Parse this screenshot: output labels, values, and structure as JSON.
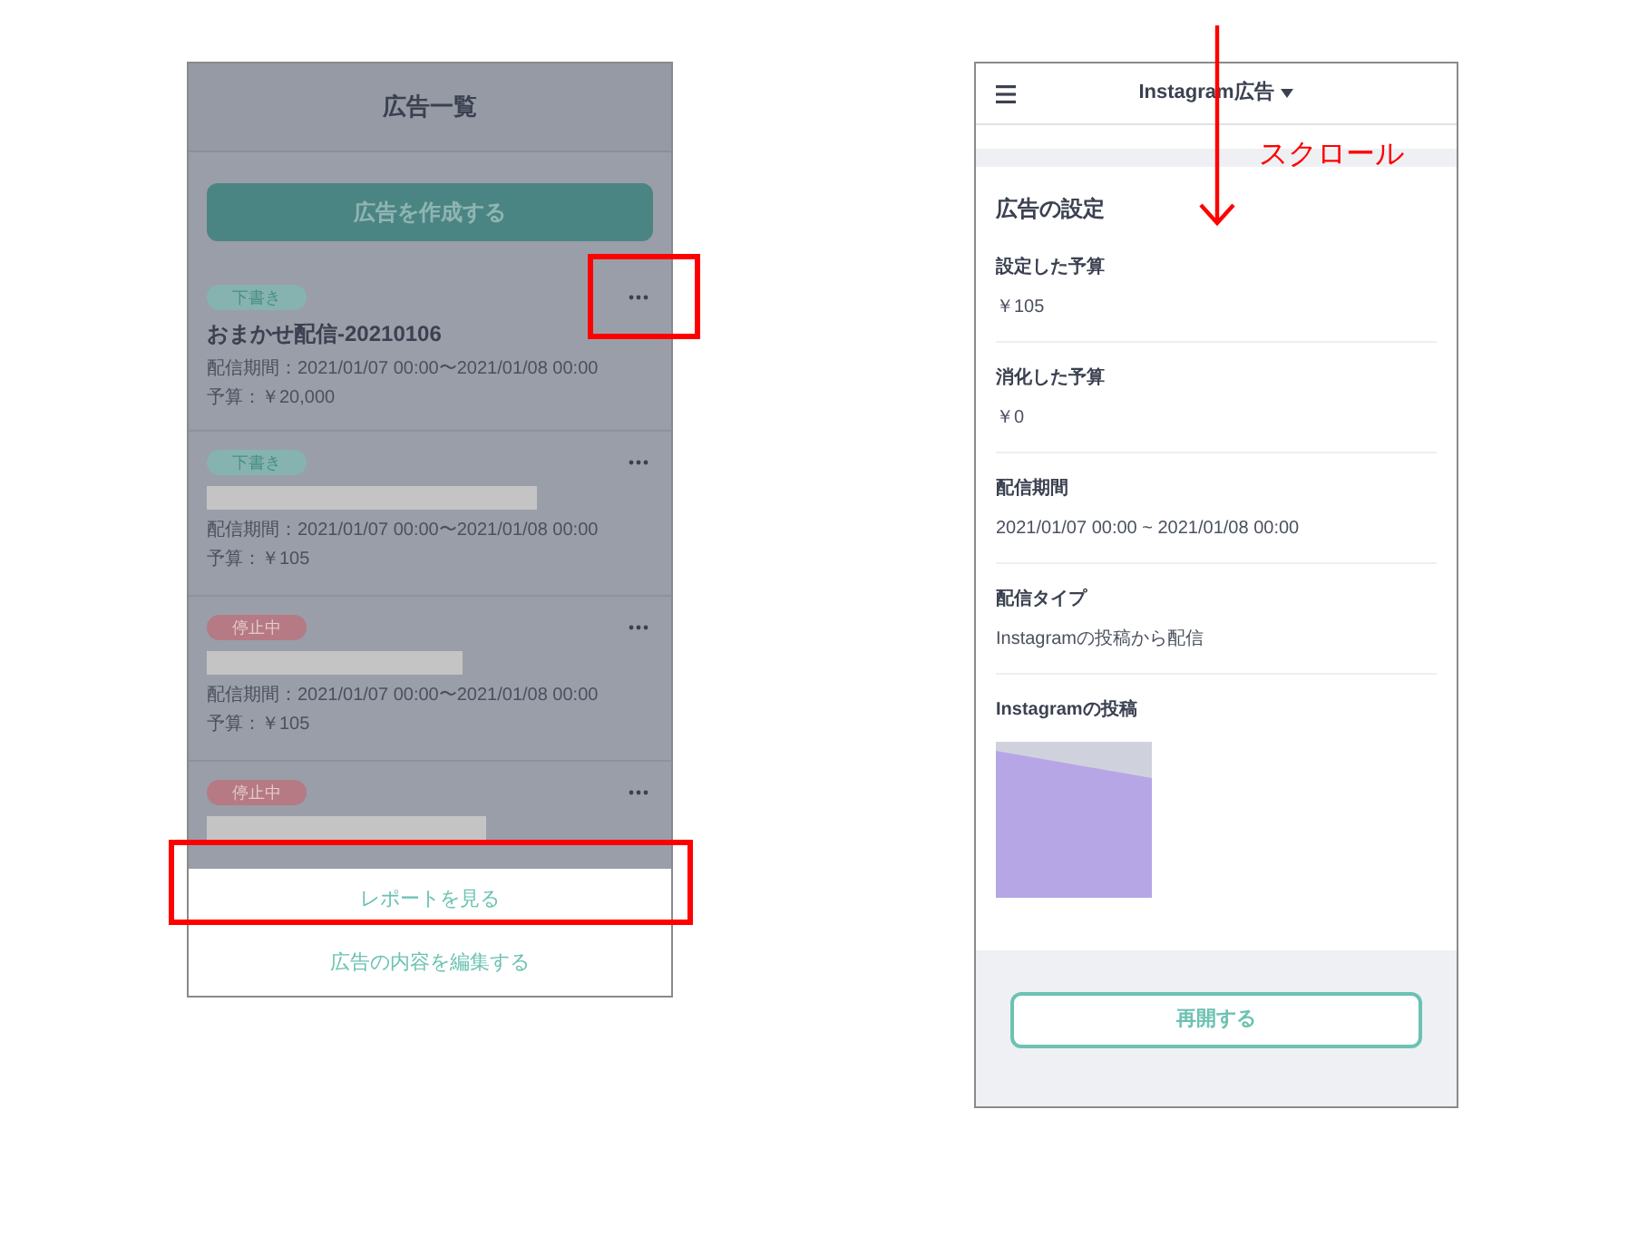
{
  "list_screen": {
    "title": "広告一覧",
    "create_button": "広告を作成する",
    "ads": [
      {
        "status": {
          "kind": "draft",
          "label": "下書き"
        },
        "title": "おまかせ配信-20210106",
        "period": "配信期間：2021/01/07 00:00〜2021/01/08 00:00",
        "budget": "予算：￥20,000"
      },
      {
        "status": {
          "kind": "draft",
          "label": "下書き"
        },
        "period": "配信期間：2021/01/07 00:00〜2021/01/08 00:00",
        "budget": "予算：￥105"
      },
      {
        "status": {
          "kind": "stopped",
          "label": "停止中"
        },
        "period": "配信期間：2021/01/07 00:00〜2021/01/08 00:00",
        "budget": "予算：￥105"
      },
      {
        "status": {
          "kind": "stopped",
          "label": "停止中"
        }
      }
    ],
    "action_sheet": [
      "レポートを見る",
      "広告の内容を編集する"
    ]
  },
  "detail_screen": {
    "title": "Instagram広告",
    "section_title": "広告の設定",
    "fields": [
      {
        "kind": "text",
        "label": "設定した予算",
        "value": "￥105"
      },
      {
        "kind": "text",
        "label": "消化した予算",
        "value": "￥0"
      },
      {
        "kind": "text",
        "label": "配信期間",
        "value": "2021/01/07 00:00 ~ 2021/01/08 00:00"
      },
      {
        "kind": "text",
        "label": "配信タイプ",
        "value": "Instagramの投稿から配信"
      },
      {
        "kind": "image",
        "label": "Instagramの投稿"
      }
    ],
    "resume_button": "再開する"
  },
  "annotation": {
    "scroll_label": "スクロール"
  }
}
